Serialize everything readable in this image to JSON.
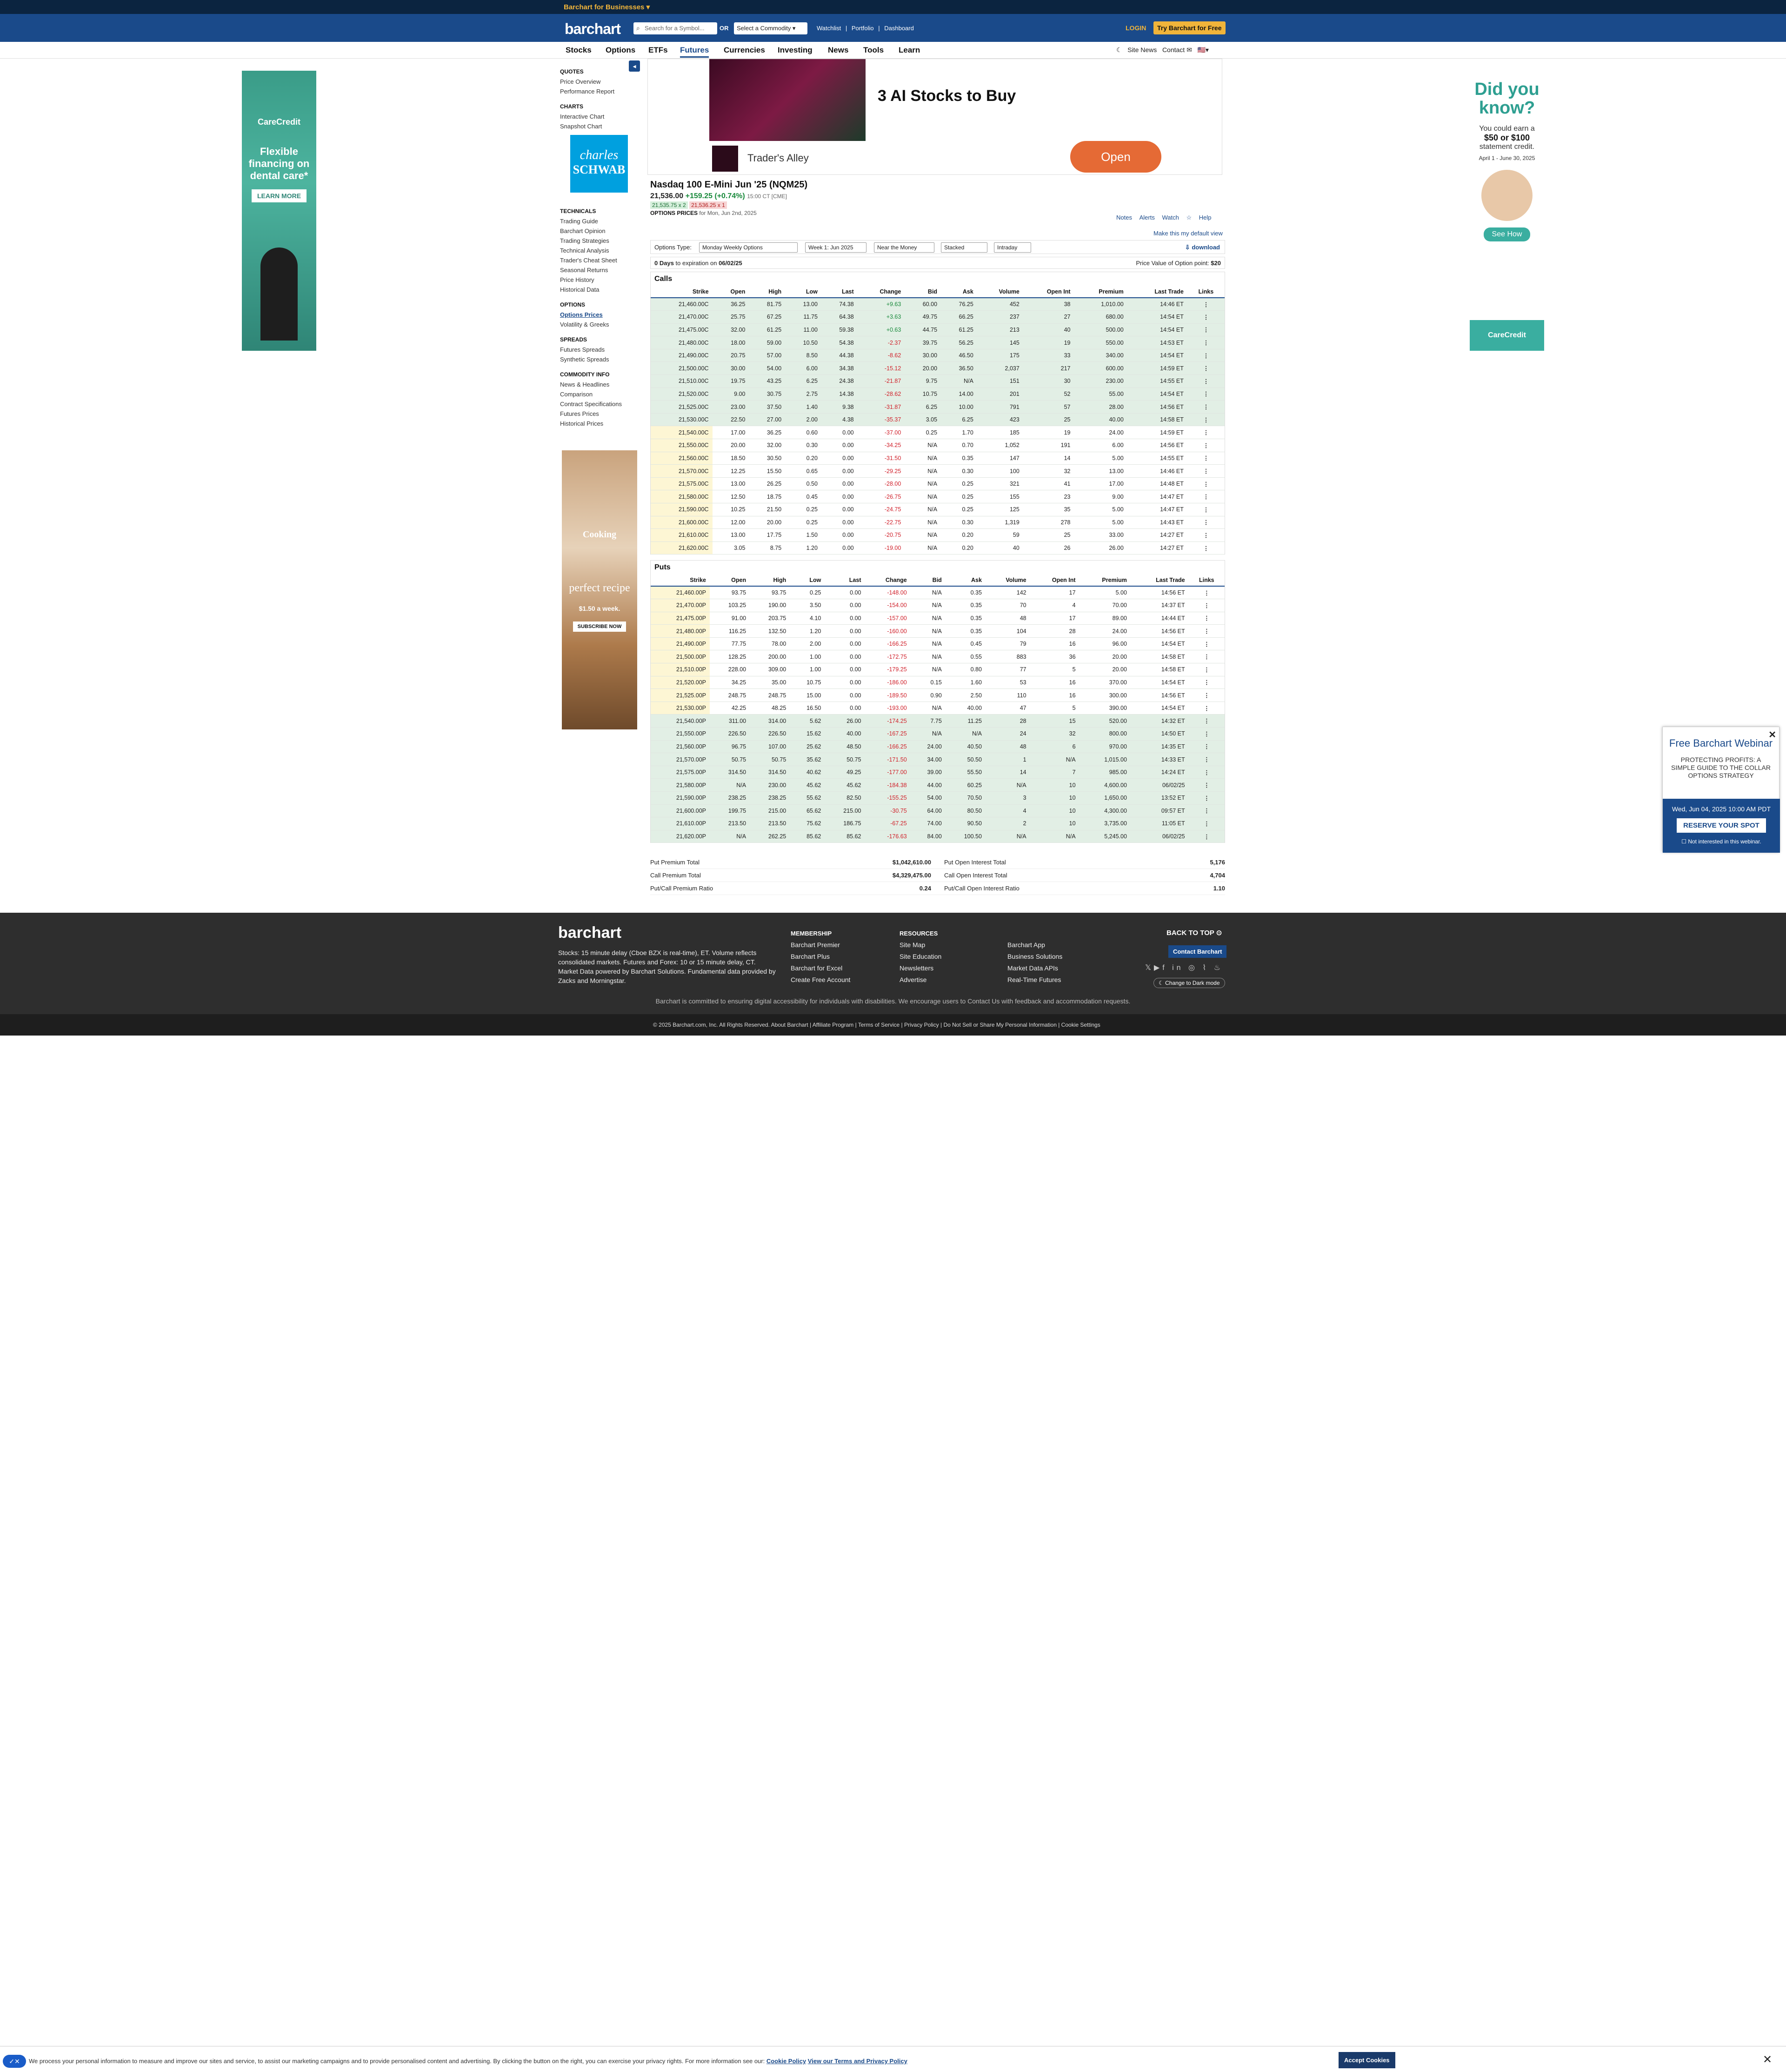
{
  "header": {
    "business_link": "Barchart for Businesses ▾",
    "logo": "barchart",
    "search_placeholder": "Search for a Symbol...",
    "or_label": "OR",
    "commodity_select": "Select a Commodity ▾",
    "links": [
      "Watchlist",
      "|",
      "Portfolio",
      "|",
      "Dashboard"
    ],
    "login": "LOGIN",
    "try_free": "Try Barchart for Free"
  },
  "nav": {
    "items": [
      "Stocks",
      "Options",
      "ETFs",
      "Futures",
      "Currencies",
      "Investing",
      "News",
      "Tools",
      "Learn"
    ],
    "active": "Futures",
    "site_news": "Site News",
    "contact": "Contact"
  },
  "sidebar": {
    "sections": [
      {
        "title": "QUOTES",
        "items": [
          "Price Overview",
          "Performance Report"
        ]
      },
      {
        "title": "CHARTS",
        "items": [
          "Interactive Chart",
          "Snapshot Chart"
        ]
      },
      {
        "title": "TECHNICALS",
        "items": [
          "Trading Guide",
          "Barchart Opinion",
          "Trading Strategies",
          "Technical Analysis",
          "Trader's Cheat Sheet",
          "Seasonal Returns",
          "Price History",
          "Historical Data"
        ]
      },
      {
        "title": "OPTIONS",
        "items": [
          "Options Prices",
          "Volatility & Greeks"
        ]
      },
      {
        "title": "SPREADS",
        "items": [
          "Futures Spreads",
          "Synthetic Spreads"
        ]
      },
      {
        "title": "COMMODITY INFO",
        "items": [
          "News & Headlines",
          "Comparison",
          "Contract Specifications",
          "Futures Prices",
          "Historical Prices"
        ]
      }
    ],
    "selected": "Options Prices"
  },
  "ads": {
    "left": {
      "brand": "CareCredit",
      "message": "Flexible financing on dental care*",
      "button": "LEARN MORE"
    },
    "schwab": {
      "line1": "charles",
      "line2": "SCHWAB"
    },
    "cooking": {
      "title": "Cooking",
      "headline": "perfect recipe",
      "price": "$1.50 a week.",
      "button": "SUBSCRIBE NOW"
    },
    "top": {
      "headline": "3 AI Stocks to Buy",
      "advertiser": "Trader's Alley",
      "button": "Open"
    },
    "right": {
      "title": "Did you know?",
      "line1": "You could earn a",
      "line2": "$50 or $100",
      "line3": "statement credit.",
      "line4": "April 1 - June 30, 2025",
      "button": "See How",
      "brand": "CareCredit"
    }
  },
  "quote": {
    "title": "Nasdaq 100 E-Mini Jun '25 (NQM25)",
    "last": "21,536.00",
    "change": "+159.25 (+0.74%)",
    "timestamp": "15:00 CT [CME]",
    "bid": "21,535.75 x 2",
    "ask": "21,536.25 x 1",
    "options_label": "OPTIONS PRICES",
    "options_date": "for Mon, Jun 2nd, 2025",
    "tools": [
      "Notes",
      "Alerts",
      "Watch",
      "Help"
    ],
    "default_view": "Make this my default view"
  },
  "filters": {
    "label": "Options Type:",
    "type": "Monday Weekly Options",
    "week": "Week 1: Jun 2025",
    "money": "Near the Money",
    "layout": "Stacked",
    "period": "Intraday",
    "download": "download"
  },
  "expiry": {
    "days": "0 Days",
    "text": "to expiration on",
    "date": "06/02/25",
    "point_label": "Price Value of Option point:",
    "point_value": "$20"
  },
  "columns": [
    "Strike",
    "Open",
    "High",
    "Low",
    "Last",
    "Change",
    "Bid",
    "Ask",
    "Volume",
    "Open Int",
    "Premium",
    "Last Trade",
    "Links"
  ],
  "calls_title": "Calls",
  "calls": [
    [
      "21,460.00C",
      "36.25",
      "81.75",
      "13.00",
      "74.38",
      "+9.63",
      "60.00",
      "76.25",
      "452",
      "38",
      "1,010.00",
      "14:46 ET",
      "⋮"
    ],
    [
      "21,470.00C",
      "25.75",
      "67.25",
      "11.75",
      "64.38",
      "+3.63",
      "49.75",
      "66.25",
      "237",
      "27",
      "680.00",
      "14:54 ET",
      "⋮"
    ],
    [
      "21,475.00C",
      "32.00",
      "61.25",
      "11.00",
      "59.38",
      "+0.63",
      "44.75",
      "61.25",
      "213",
      "40",
      "500.00",
      "14:54 ET",
      "⋮"
    ],
    [
      "21,480.00C",
      "18.00",
      "59.00",
      "10.50",
      "54.38",
      "-2.37",
      "39.75",
      "56.25",
      "145",
      "19",
      "550.00",
      "14:53 ET",
      "⋮"
    ],
    [
      "21,490.00C",
      "20.75",
      "57.00",
      "8.50",
      "44.38",
      "-8.62",
      "30.00",
      "46.50",
      "175",
      "33",
      "340.00",
      "14:54 ET",
      "⋮"
    ],
    [
      "21,500.00C",
      "30.00",
      "54.00",
      "6.00",
      "34.38",
      "-15.12",
      "20.00",
      "36.50",
      "2,037",
      "217",
      "600.00",
      "14:59 ET",
      "⋮"
    ],
    [
      "21,510.00C",
      "19.75",
      "43.25",
      "6.25",
      "24.38",
      "-21.87",
      "9.75",
      "N/A",
      "151",
      "30",
      "230.00",
      "14:55 ET",
      "⋮"
    ],
    [
      "21,520.00C",
      "9.00",
      "30.75",
      "2.75",
      "14.38",
      "-28.62",
      "10.75",
      "14.00",
      "201",
      "52",
      "55.00",
      "14:54 ET",
      "⋮"
    ],
    [
      "21,525.00C",
      "23.00",
      "37.50",
      "1.40",
      "9.38",
      "-31.87",
      "6.25",
      "10.00",
      "791",
      "57",
      "28.00",
      "14:56 ET",
      "⋮"
    ],
    [
      "21,530.00C",
      "22.50",
      "27.00",
      "2.00",
      "4.38",
      "-35.37",
      "3.05",
      "6.25",
      "423",
      "25",
      "40.00",
      "14:58 ET",
      "⋮"
    ],
    [
      "21,540.00C",
      "17.00",
      "36.25",
      "0.60",
      "0.00",
      "-37.00",
      "0.25",
      "1.70",
      "185",
      "19",
      "24.00",
      "14:59 ET",
      "⋮"
    ],
    [
      "21,550.00C",
      "20.00",
      "32.00",
      "0.30",
      "0.00",
      "-34.25",
      "N/A",
      "0.70",
      "1,052",
      "191",
      "6.00",
      "14:56 ET",
      "⋮"
    ],
    [
      "21,560.00C",
      "18.50",
      "30.50",
      "0.20",
      "0.00",
      "-31.50",
      "N/A",
      "0.35",
      "147",
      "14",
      "5.00",
      "14:55 ET",
      "⋮"
    ],
    [
      "21,570.00C",
      "12.25",
      "15.50",
      "0.65",
      "0.00",
      "-29.25",
      "N/A",
      "0.30",
      "100",
      "32",
      "13.00",
      "14:46 ET",
      "⋮"
    ],
    [
      "21,575.00C",
      "13.00",
      "26.25",
      "0.50",
      "0.00",
      "-28.00",
      "N/A",
      "0.25",
      "321",
      "41",
      "17.00",
      "14:48 ET",
      "⋮"
    ],
    [
      "21,580.00C",
      "12.50",
      "18.75",
      "0.45",
      "0.00",
      "-26.75",
      "N/A",
      "0.25",
      "155",
      "23",
      "9.00",
      "14:47 ET",
      "⋮"
    ],
    [
      "21,590.00C",
      "10.25",
      "21.50",
      "0.25",
      "0.00",
      "-24.75",
      "N/A",
      "0.25",
      "125",
      "35",
      "5.00",
      "14:47 ET",
      "⋮"
    ],
    [
      "21,600.00C",
      "12.00",
      "20.00",
      "0.25",
      "0.00",
      "-22.75",
      "N/A",
      "0.30",
      "1,319",
      "278",
      "5.00",
      "14:43 ET",
      "⋮"
    ],
    [
      "21,610.00C",
      "13.00",
      "17.75",
      "1.50",
      "0.00",
      "-20.75",
      "N/A",
      "0.20",
      "59",
      "25",
      "33.00",
      "14:27 ET",
      "⋮"
    ],
    [
      "21,620.00C",
      "3.05",
      "8.75",
      "1.20",
      "0.00",
      "-19.00",
      "N/A",
      "0.20",
      "40",
      "26",
      "26.00",
      "14:27 ET",
      "⋮"
    ]
  ],
  "calls_itm_count": 10,
  "puts_title": "Puts",
  "puts": [
    [
      "21,460.00P",
      "93.75",
      "93.75",
      "0.25",
      "0.00",
      "-148.00",
      "N/A",
      "0.35",
      "142",
      "17",
      "5.00",
      "14:56 ET",
      "⋮"
    ],
    [
      "21,470.00P",
      "103.25",
      "190.00",
      "3.50",
      "0.00",
      "-154.00",
      "N/A",
      "0.35",
      "70",
      "4",
      "70.00",
      "14:37 ET",
      "⋮"
    ],
    [
      "21,475.00P",
      "91.00",
      "203.75",
      "4.10",
      "0.00",
      "-157.00",
      "N/A",
      "0.35",
      "48",
      "17",
      "89.00",
      "14:44 ET",
      "⋮"
    ],
    [
      "21,480.00P",
      "116.25",
      "132.50",
      "1.20",
      "0.00",
      "-160.00",
      "N/A",
      "0.35",
      "104",
      "28",
      "24.00",
      "14:56 ET",
      "⋮"
    ],
    [
      "21,490.00P",
      "77.75",
      "78.00",
      "2.00",
      "0.00",
      "-166.25",
      "N/A",
      "0.45",
      "79",
      "16",
      "96.00",
      "14:54 ET",
      "⋮"
    ],
    [
      "21,500.00P",
      "128.25",
      "200.00",
      "1.00",
      "0.00",
      "-172.75",
      "N/A",
      "0.55",
      "883",
      "36",
      "20.00",
      "14:58 ET",
      "⋮"
    ],
    [
      "21,510.00P",
      "228.00",
      "309.00",
      "1.00",
      "0.00",
      "-179.25",
      "N/A",
      "0.80",
      "77",
      "5",
      "20.00",
      "14:58 ET",
      "⋮"
    ],
    [
      "21,520.00P",
      "34.25",
      "35.00",
      "10.75",
      "0.00",
      "-186.00",
      "0.15",
      "1.60",
      "53",
      "16",
      "370.00",
      "14:54 ET",
      "⋮"
    ],
    [
      "21,525.00P",
      "248.75",
      "248.75",
      "15.00",
      "0.00",
      "-189.50",
      "0.90",
      "2.50",
      "110",
      "16",
      "300.00",
      "14:56 ET",
      "⋮"
    ],
    [
      "21,530.00P",
      "42.25",
      "48.25",
      "16.50",
      "0.00",
      "-193.00",
      "N/A",
      "40.00",
      "47",
      "5",
      "390.00",
      "14:54 ET",
      "⋮"
    ],
    [
      "21,540.00P",
      "311.00",
      "314.00",
      "5.62",
      "26.00",
      "-174.25",
      "7.75",
      "11.25",
      "28",
      "15",
      "520.00",
      "14:32 ET",
      "⋮"
    ],
    [
      "21,550.00P",
      "226.50",
      "226.50",
      "15.62",
      "40.00",
      "-167.25",
      "N/A",
      "N/A",
      "24",
      "32",
      "800.00",
      "14:50 ET",
      "⋮"
    ],
    [
      "21,560.00P",
      "96.75",
      "107.00",
      "25.62",
      "48.50",
      "-166.25",
      "24.00",
      "40.50",
      "48",
      "6",
      "970.00",
      "14:35 ET",
      "⋮"
    ],
    [
      "21,570.00P",
      "50.75",
      "50.75",
      "35.62",
      "50.75",
      "-171.50",
      "34.00",
      "50.50",
      "1",
      "N/A",
      "1,015.00",
      "14:33 ET",
      "⋮"
    ],
    [
      "21,575.00P",
      "314.50",
      "314.50",
      "40.62",
      "49.25",
      "-177.00",
      "39.00",
      "55.50",
      "14",
      "7",
      "985.00",
      "14:24 ET",
      "⋮"
    ],
    [
      "21,580.00P",
      "N/A",
      "230.00",
      "45.62",
      "45.62",
      "-184.38",
      "44.00",
      "60.25",
      "N/A",
      "10",
      "4,600.00",
      "06/02/25",
      "⋮"
    ],
    [
      "21,590.00P",
      "238.25",
      "238.25",
      "55.62",
      "82.50",
      "-155.25",
      "54.00",
      "70.50",
      "3",
      "10",
      "1,650.00",
      "13:52 ET",
      "⋮"
    ],
    [
      "21,600.00P",
      "199.75",
      "215.00",
      "65.62",
      "215.00",
      "-30.75",
      "64.00",
      "80.50",
      "4",
      "10",
      "4,300.00",
      "09:57 ET",
      "⋮"
    ],
    [
      "21,610.00P",
      "213.50",
      "213.50",
      "75.62",
      "186.75",
      "-67.25",
      "74.00",
      "90.50",
      "2",
      "10",
      "3,735.00",
      "11:05 ET",
      "⋮"
    ],
    [
      "21,620.00P",
      "N/A",
      "262.25",
      "85.62",
      "85.62",
      "-176.63",
      "84.00",
      "100.50",
      "N/A",
      "N/A",
      "5,245.00",
      "06/02/25",
      "⋮"
    ]
  ],
  "puts_itm_start": 10,
  "totals": [
    {
      "l1": "Put Premium Total",
      "v1": "$1,042,610.00",
      "l2": "Put Open Interest Total",
      "v2": "5,176"
    },
    {
      "l1": "Call Premium Total",
      "v1": "$4,329,475.00",
      "l2": "Call Open Interest Total",
      "v2": "4,704"
    },
    {
      "l1": "Put/Call Premium Ratio",
      "v1": "0.24",
      "l2": "Put/Call Open Interest Ratio",
      "v2": "1.10"
    }
  ],
  "footer": {
    "logo": "barchart",
    "desc": "Stocks: 15 minute delay (Cboe BZX is real-time), ET. Volume reflects consolidated markets. Futures and Forex: 10 or 15 minute delay, CT. Market Data powered by Barchart Solutions. Fundamental data provided by Zacks and Morningstar.",
    "membership_title": "MEMBERSHIP",
    "membership": [
      "Barchart Premier",
      "Barchart Plus",
      "Barchart for Excel",
      "Create Free Account"
    ],
    "resources_title": "RESOURCES",
    "resources": [
      "Site Map",
      "Site Education",
      "Newsletters",
      "Advertise"
    ],
    "more": [
      "Barchart App",
      "Business Solutions",
      "Market Data APIs",
      "Real-Time Futures"
    ],
    "back_to_top": "BACK TO TOP",
    "contact": "Contact Barchart",
    "dark_mode": "Change to Dark mode",
    "accessibility": "Barchart is committed to ensuring digital accessibility for individuals with disabilities. We encourage users to Contact Us with feedback and accommodation requests.",
    "copyright": "© 2025 Barchart.com, Inc. All Rights Reserved.   About Barchart | Affiliate Program | Terms of Service | Privacy Policy | Do Not Sell or Share My Personal Information | Cookie Settings"
  },
  "webinar": {
    "title": "Free Barchart Webinar",
    "desc": "PROTECTING PROFITS: A SIMPLE GUIDE TO THE COLLAR OPTIONS STRATEGY",
    "date": "Wed, Jun 04, 2025 10:00 AM PDT",
    "button": "RESERVE YOUR SPOT",
    "no": "Not interested in this webinar."
  },
  "cookie": {
    "text": "We process your personal information to measure and improve our sites and service, to assist our marketing campaigns and to provide personalised content and advertising. By clicking the button on the right, you can exercise your privacy rights. For more information see our:",
    "policy": "Cookie Policy",
    "terms": "View our Terms and Privacy Policy",
    "accept": "Accept Cookies"
  }
}
